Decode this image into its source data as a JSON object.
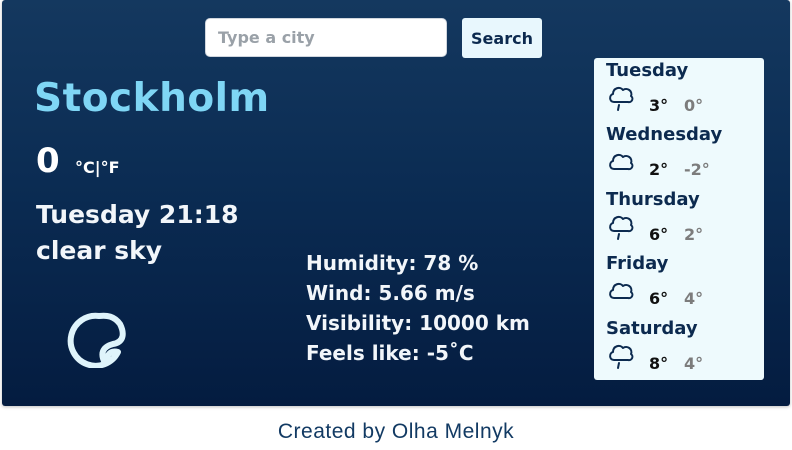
{
  "search": {
    "placeholder": "Type a city",
    "button_label": "Search"
  },
  "current": {
    "city": "Stockholm",
    "temperature": "0",
    "unit_celsius": "°C",
    "unit_separator": "|",
    "unit_fahrenheit": "°F",
    "datetime": "Tuesday 21:18",
    "description": "clear sky",
    "icon": "moon-icon"
  },
  "details": {
    "humidity": "Humidity: 78 %",
    "wind": "Wind: 5.66 m/s",
    "visibility": "Visibility: 10000 km",
    "feels_like": "Feels like: -5˚C"
  },
  "forecast": [
    {
      "day": "Tuesday",
      "max": "3°",
      "min": "0°",
      "icon": "cloud-rain-icon"
    },
    {
      "day": "Wednesday",
      "max": "2°",
      "min": "-2°",
      "icon": "cloud-icon"
    },
    {
      "day": "Thursday",
      "max": "6°",
      "min": "2°",
      "icon": "cloud-rain-icon"
    },
    {
      "day": "Friday",
      "max": "6°",
      "min": "4°",
      "icon": "cloud-icon"
    },
    {
      "day": "Saturday",
      "max": "8°",
      "min": "4°",
      "icon": "cloud-rain-icon"
    }
  ],
  "footer": {
    "credit": "Created by Olha Melnyk"
  },
  "colors": {
    "background_top": "#14385f",
    "background_bottom": "#041c40",
    "city": "#7fd6f5",
    "forecast_panel": "#eefafd",
    "footer_text": "#123a63"
  }
}
